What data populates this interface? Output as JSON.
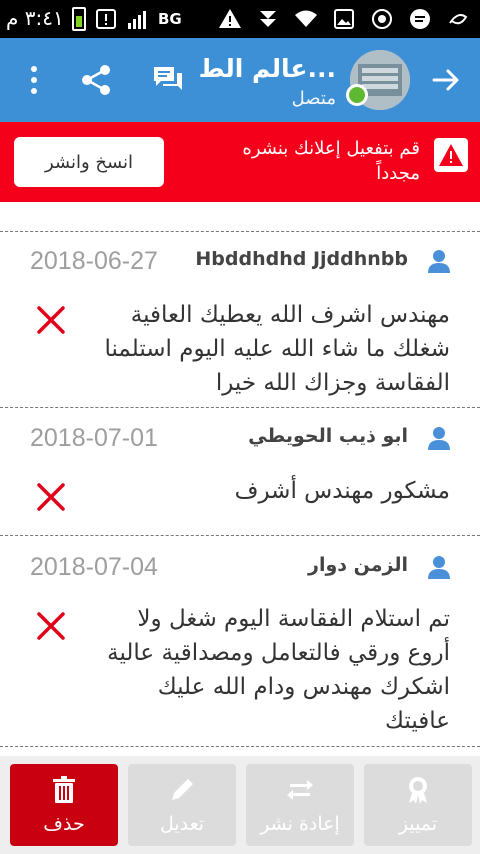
{
  "status_bar": {
    "time": "٣:٤١ م",
    "network_label": "BG",
    "icons": [
      "battery-icon",
      "alert-square-icon",
      "signal-icon",
      "warning-icon",
      "sim-icon",
      "wifi-icon",
      "image-icon",
      "whatsapp-icon",
      "message-icon",
      "swirl-app-icon"
    ]
  },
  "app_bar": {
    "title": "عالم الط...",
    "subtitle": "متصل",
    "icons": [
      "back-arrow-icon",
      "chat-icon",
      "share-icon",
      "more-vert-icon"
    ],
    "color": "#3d8fd6"
  },
  "alert": {
    "message": "قم بتفعيل إعلانك بنشره مجدداً",
    "button_label": "انسخ وانشر",
    "color": "#f5001b"
  },
  "comments": [
    {
      "date": "2018-06-27",
      "author": "Hbddhdhd Jjddhnbb",
      "text": "مهندس اشرف الله يعطيك العافية شغلك ما شاء الله عليه اليوم استلمنا الفقاسة وجزاك الله خيرا"
    },
    {
      "date": "2018-07-01",
      "author": "ابو ذيب الحويطي",
      "text": "مشكور مهندس أشرف"
    },
    {
      "date": "2018-07-04",
      "author": "الزمن دوار",
      "text": "تم استلام الفقاسة اليوم شغل ولا أروع ورقي فالتعامل ومصداقية عالية اشكرك مهندس ودام الله عليك عافيتك"
    }
  ],
  "toolbar": {
    "delete_label": "حذف",
    "edit_label": "تعديل",
    "republish_label": "إعادة نشر",
    "feature_label": "تمييز",
    "active_color": "#c9000f"
  }
}
